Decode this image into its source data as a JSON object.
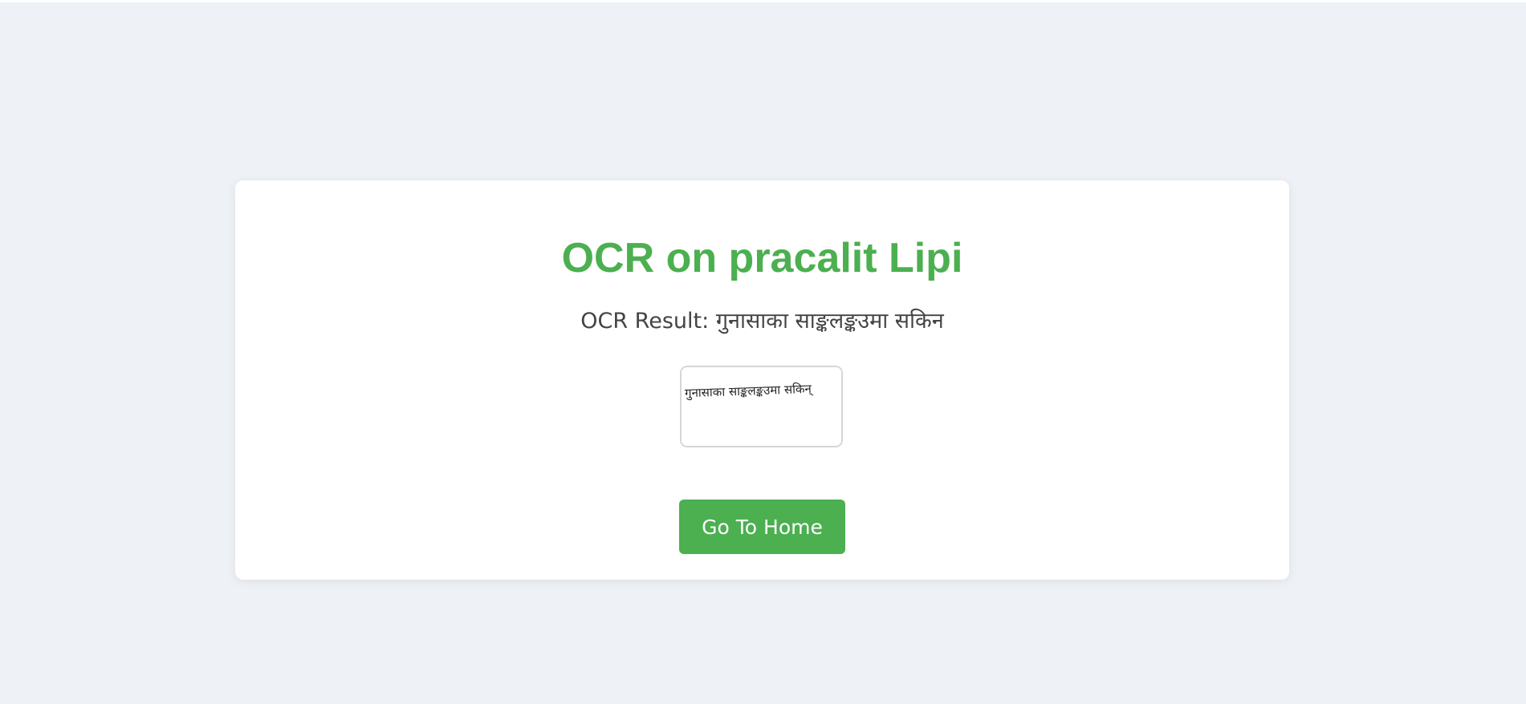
{
  "page": {
    "title": "OCR on pracalit Lipi",
    "result_label": "OCR Result:",
    "result_text": "गुनासाका साङ्कलङ्कउमा सकिन",
    "image_text": "गुनासाका साङ्कलङ्कउमा सकिन्",
    "home_button_label": "Go To Home"
  },
  "colors": {
    "background": "#eef1f6",
    "card": "#ffffff",
    "accent": "#4caf50",
    "text": "#444444"
  }
}
